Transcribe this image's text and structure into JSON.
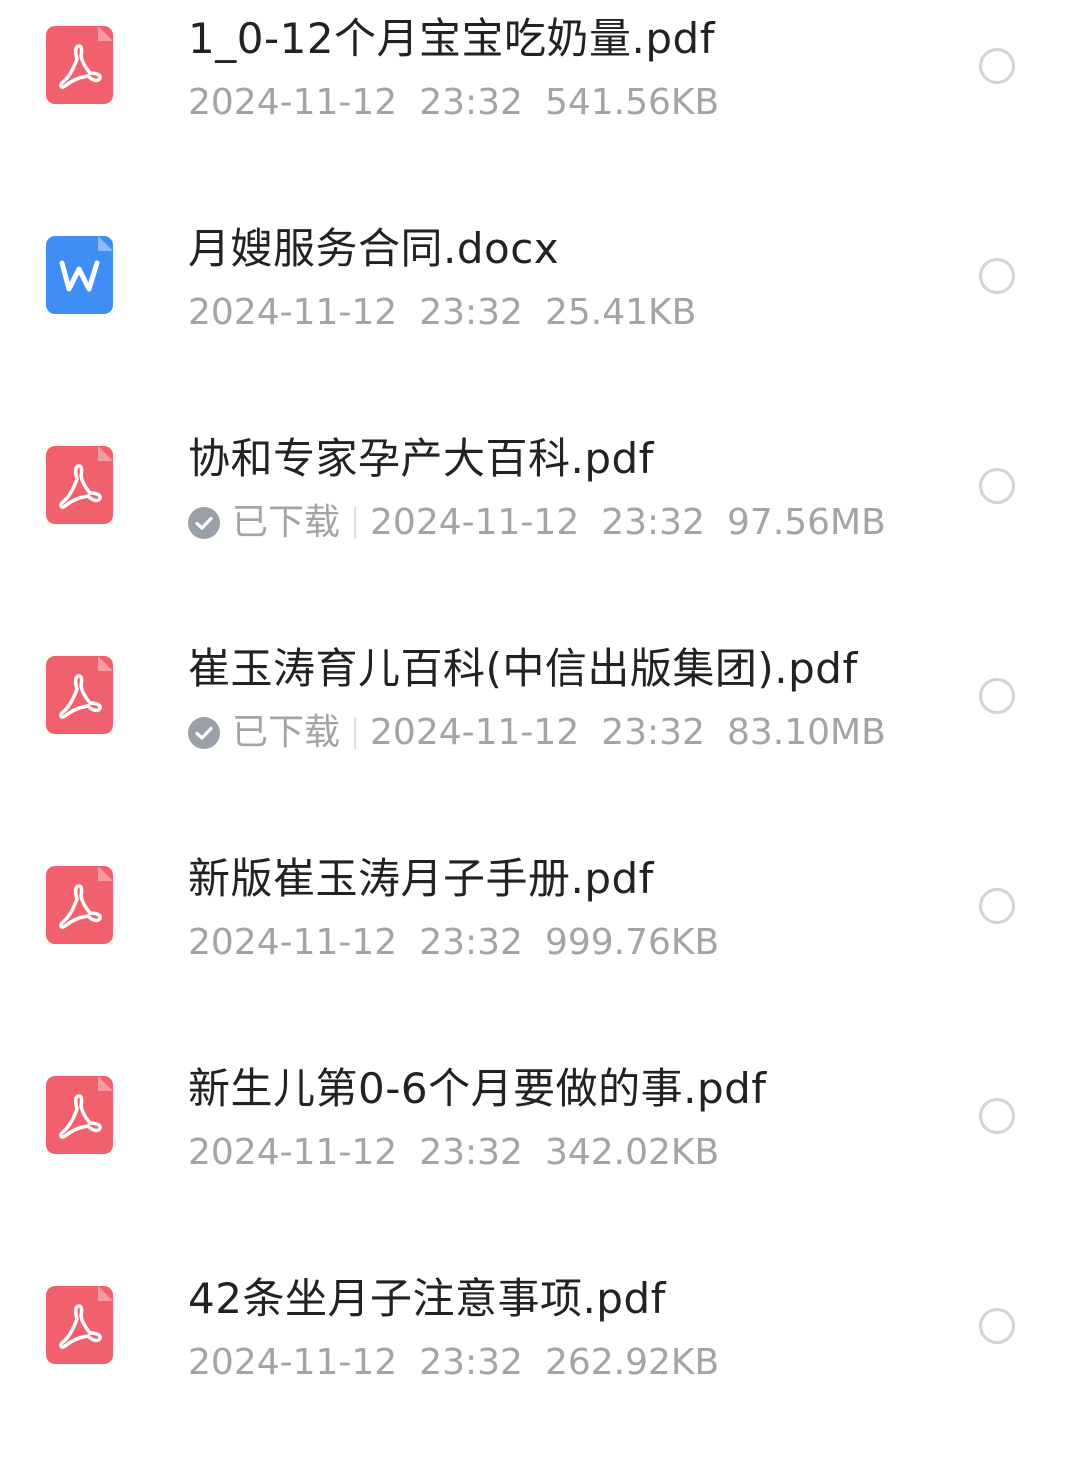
{
  "files": [
    {
      "name": "1_0-12个月宝宝吃奶量.pdf",
      "type": "pdf",
      "date": "2024-11-12",
      "time": "23:32",
      "size": "541.56KB"
    },
    {
      "name": "月嫂服务合同.docx",
      "type": "docx",
      "date": "2024-11-12",
      "time": "23:32",
      "size": "25.41KB"
    },
    {
      "name": "协和专家孕产大百科.pdf",
      "type": "pdf",
      "status": "已下载",
      "date": "2024-11-12",
      "time": "23:32",
      "size": "97.56MB"
    },
    {
      "name": "崔玉涛育儿百科(中信出版集团).pdf",
      "type": "pdf",
      "status": "已下载",
      "date": "2024-11-12",
      "time": "23:32",
      "size": "83.10MB"
    },
    {
      "name": "新版崔玉涛月子手册.pdf",
      "type": "pdf",
      "date": "2024-11-12",
      "time": "23:32",
      "size": "999.76KB"
    },
    {
      "name": "新生儿第0-6个月要做的事.pdf",
      "type": "pdf",
      "date": "2024-11-12",
      "time": "23:32",
      "size": "342.02KB"
    },
    {
      "name": "42条坐月子注意事项.pdf",
      "type": "pdf",
      "date": "2024-11-12",
      "time": "23:32",
      "size": "262.92KB"
    }
  ],
  "colors": {
    "pdf_icon": "#f1616d",
    "docx_icon": "#3f8ef5",
    "name_text": "#222222",
    "meta_text": "#a4a4a4",
    "radio_border": "#d4d4d4",
    "check_badge": "#9aa0a8"
  },
  "icons": {
    "pdf": "pdf-file-icon",
    "docx": "word-file-icon",
    "downloaded": "check-circle-icon",
    "select": "radio-circle-icon"
  }
}
